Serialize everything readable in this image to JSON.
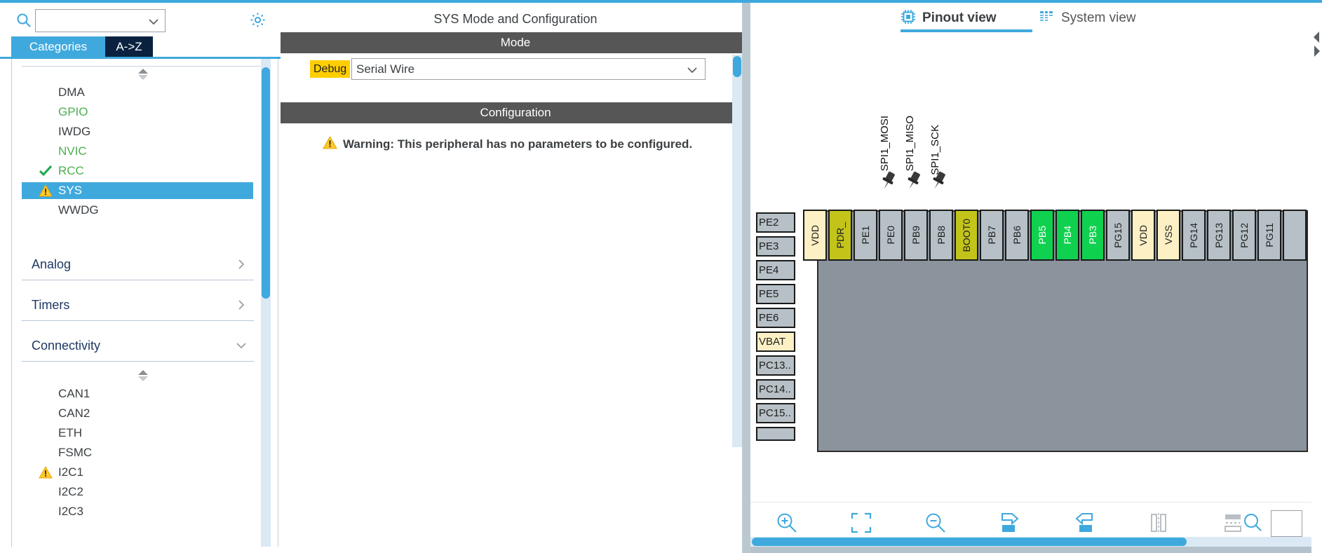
{
  "theme": {
    "accent": "#3fa9dd",
    "dark_navy": "#0a2240",
    "section_header_bg": "#565656",
    "warning_yellow": "#ffce00",
    "green_pin": "#0fd14f",
    "power_pin": "#fcf0c4",
    "boot_pin": "#c3c41a",
    "default_pin": "#b6c0c6",
    "chip_body": "#8b949c"
  },
  "left_panel": {
    "search": {
      "value": "",
      "placeholder": "",
      "icon": "search-icon"
    },
    "settings_icon": "gear-icon",
    "tabs": [
      {
        "label": "Categories",
        "active": true
      },
      {
        "label": "A->Z",
        "active": false
      }
    ],
    "peripherals": [
      {
        "label": "DMA",
        "status": "none",
        "selected": false
      },
      {
        "label": "GPIO",
        "status": "green",
        "selected": false
      },
      {
        "label": "IWDG",
        "status": "none",
        "selected": false
      },
      {
        "label": "NVIC",
        "status": "green",
        "selected": false
      },
      {
        "label": "RCC",
        "status": "check",
        "selected": false
      },
      {
        "label": "SYS",
        "status": "warning",
        "selected": true
      },
      {
        "label": "WWDG",
        "status": "none",
        "selected": false
      }
    ],
    "groups": [
      {
        "label": "Analog",
        "expanded": false,
        "chevron": "chevron-right-icon"
      },
      {
        "label": "Timers",
        "expanded": false,
        "chevron": "chevron-right-icon"
      },
      {
        "label": "Connectivity",
        "expanded": true,
        "chevron": "chevron-down-icon"
      }
    ],
    "connectivity_items": [
      {
        "label": "CAN1",
        "status": "none"
      },
      {
        "label": "CAN2",
        "status": "none"
      },
      {
        "label": "ETH",
        "status": "none"
      },
      {
        "label": "FSMC",
        "status": "none"
      },
      {
        "label": "I2C1",
        "status": "warning"
      },
      {
        "label": "I2C2",
        "status": "none"
      },
      {
        "label": "I2C3",
        "status": "none"
      }
    ]
  },
  "center_panel": {
    "title": "SYS Mode and Configuration",
    "mode_header": "Mode",
    "mode_row": {
      "badge": "Debug",
      "selected_value": "Serial Wire",
      "chevron": "chevron-down-icon"
    },
    "configuration_header": "Configuration",
    "warning": {
      "icon": "warning-triangle-icon",
      "text": "Warning: This peripheral has no parameters to be configured."
    }
  },
  "right_panel": {
    "tabs": [
      {
        "label": "Pinout view",
        "icon": "chip-icon",
        "active": true
      },
      {
        "label": "System view",
        "icon": "list-icon",
        "active": false
      }
    ],
    "chip": {
      "top_pins": [
        {
          "label": "VDD",
          "kind": "power",
          "alt": ""
        },
        {
          "label": "PDR_",
          "kind": "boot",
          "alt": ""
        },
        {
          "label": "PE1",
          "kind": "default",
          "alt": ""
        },
        {
          "label": "PE0",
          "kind": "default",
          "alt": ""
        },
        {
          "label": "PB9",
          "kind": "default",
          "alt": ""
        },
        {
          "label": "PB8",
          "kind": "default",
          "alt": ""
        },
        {
          "label": "BOOT0",
          "kind": "boot",
          "alt": ""
        },
        {
          "label": "PB7",
          "kind": "default",
          "alt": ""
        },
        {
          "label": "PB6",
          "kind": "default",
          "alt": ""
        },
        {
          "label": "PB5",
          "kind": "green",
          "alt": "SPI1_MOSI"
        },
        {
          "label": "PB4",
          "kind": "green",
          "alt": "SPI1_MISO"
        },
        {
          "label": "PB3",
          "kind": "green",
          "alt": "SPI1_SCK"
        },
        {
          "label": "PG15",
          "kind": "default",
          "alt": ""
        },
        {
          "label": "VDD",
          "kind": "power",
          "alt": ""
        },
        {
          "label": "VSS",
          "kind": "power",
          "alt": ""
        },
        {
          "label": "PG14",
          "kind": "default",
          "alt": ""
        },
        {
          "label": "PG13",
          "kind": "default",
          "alt": ""
        },
        {
          "label": "PG12",
          "kind": "default",
          "alt": ""
        },
        {
          "label": "PG11",
          "kind": "default",
          "alt": ""
        }
      ],
      "left_pins": [
        {
          "label": "PE2",
          "kind": "default"
        },
        {
          "label": "PE3",
          "kind": "default"
        },
        {
          "label": "PE4",
          "kind": "default"
        },
        {
          "label": "PE5",
          "kind": "default"
        },
        {
          "label": "PE6",
          "kind": "default"
        },
        {
          "label": "VBAT",
          "kind": "power"
        },
        {
          "label": "PC13..",
          "kind": "default"
        },
        {
          "label": "PC14..",
          "kind": "default"
        },
        {
          "label": "PC15..",
          "kind": "default"
        }
      ]
    },
    "toolbar": [
      {
        "name": "zoom-in-icon",
        "title": "Zoom In"
      },
      {
        "name": "fit-to-screen-icon",
        "title": "Fit"
      },
      {
        "name": "zoom-out-icon",
        "title": "Zoom Out"
      },
      {
        "name": "rotate-right-icon",
        "title": "Rotate Right"
      },
      {
        "name": "rotate-left-icon",
        "title": "Rotate Left"
      },
      {
        "name": "flip-vertical-icon",
        "title": "Flip"
      },
      {
        "name": "keep-layout-icon",
        "title": "Layout"
      },
      {
        "name": "search-icon",
        "title": "Find"
      }
    ],
    "toolbar_search": {
      "value": "",
      "placeholder": ""
    }
  }
}
